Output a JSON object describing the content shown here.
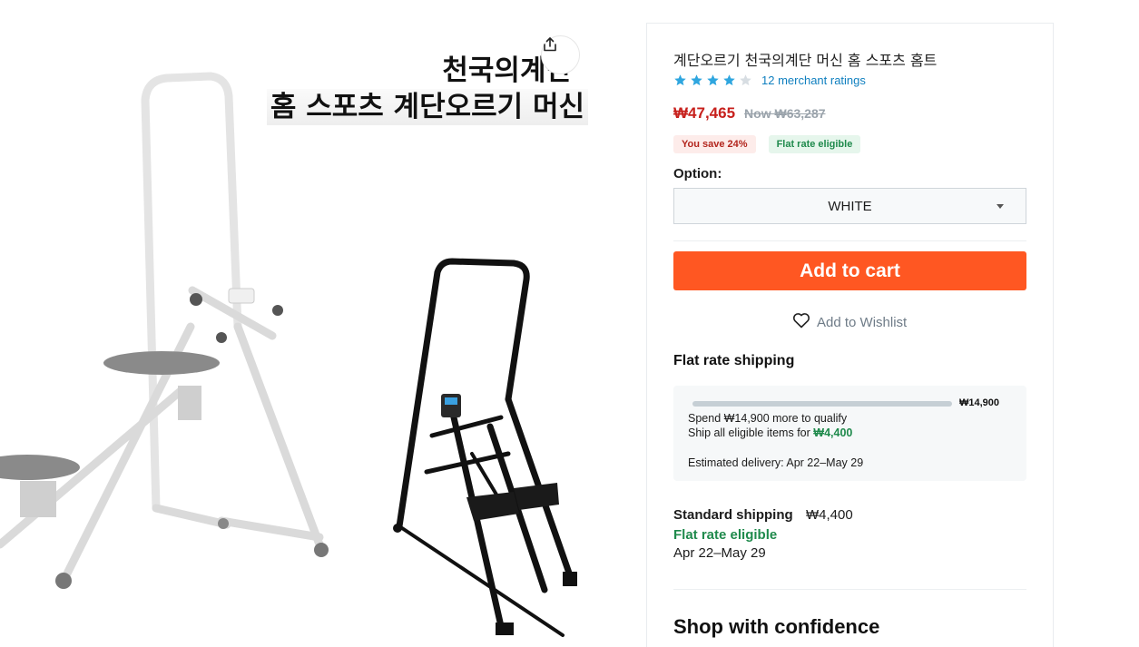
{
  "product": {
    "image_caption_line1": "천국의계단",
    "image_caption_line2": "홈 스포츠 계단오르기 머신",
    "title": "계단오르기 천국의계단 머신 홈 스포츠 홈트",
    "rating_stars": 4,
    "rating_max": 5,
    "ratings_text": "12 merchant ratings",
    "price_now": "₩47,465",
    "price_was": "Now ₩63,287",
    "badge_save": "You save 24%",
    "badge_flat": "Flat rate eligible"
  },
  "option": {
    "label": "Option:",
    "selected": "WHITE"
  },
  "actions": {
    "add_to_cart": "Add to cart",
    "wishlist": "Add to Wishlist",
    "share_icon": "share-icon"
  },
  "flat_rate": {
    "heading": "Flat rate shipping",
    "threshold": "₩14,900",
    "progress_fraction": 0,
    "spend_text": "Spend ₩14,900 more to qualify",
    "ship_all_prefix": "Ship all eligible items for ",
    "ship_all_price": "₩4,400",
    "estimated": "Estimated delivery: Apr 22–May 29"
  },
  "standard": {
    "label": "Standard shipping",
    "price": "₩4,400",
    "eligible": "Flat rate eligible",
    "dates": "Apr 22–May 29"
  },
  "confidence": {
    "heading": "Shop with confidence"
  },
  "colors": {
    "accent": "#ff5722",
    "price_red": "#c7201c",
    "green": "#1f8a4c",
    "star_blue": "#2fa6df",
    "star_empty": "#d7dde2"
  }
}
